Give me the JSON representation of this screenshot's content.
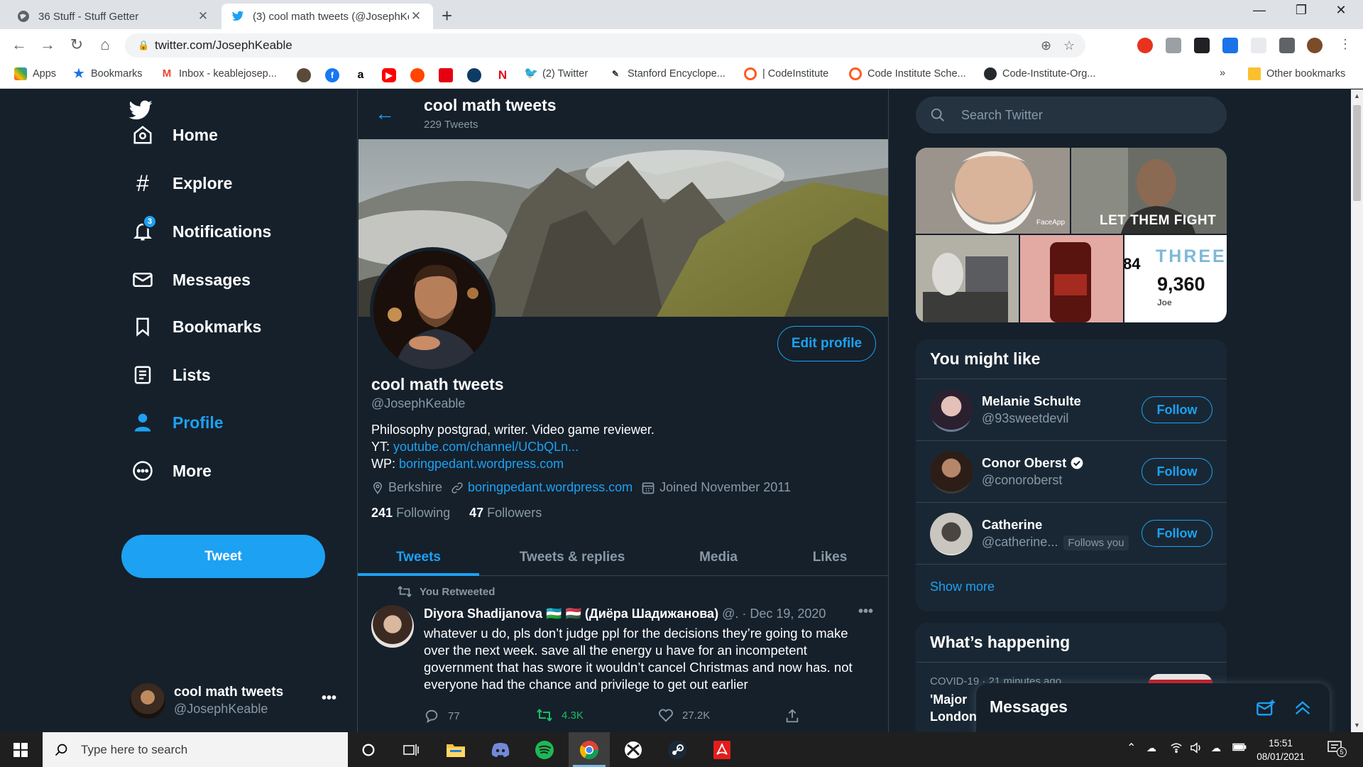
{
  "browser": {
    "tabs": [
      {
        "title": "36 Stuff - Stuff Getter",
        "active": false
      },
      {
        "title": "(3) cool math tweets (@JosephKe",
        "active": true
      }
    ],
    "url": "twitter.com/JosephKeable",
    "bookmarks": [
      {
        "label": "Apps",
        "icon": "apps-grid-icon"
      },
      {
        "label": "Bookmarks",
        "icon": "star-icon"
      },
      {
        "label": "Inbox - keablejosep...",
        "icon": "gmail-icon"
      },
      {
        "label": "(2) Twitter",
        "icon": "twitter-icon"
      },
      {
        "label": "Stanford Encyclope...",
        "icon": "sep-icon"
      },
      {
        "label": "| CodeInstitute",
        "icon": "codeinstitute-icon"
      },
      {
        "label": "Code Institute Sche...",
        "icon": "codeinstitute-icon"
      },
      {
        "label": "Code-Institute-Org...",
        "icon": "github-icon"
      }
    ],
    "other_bookmarks": "Other bookmarks",
    "overflow": "»"
  },
  "sidebar": {
    "items": [
      {
        "label": "Home",
        "icon": "home-icon"
      },
      {
        "label": "Explore",
        "icon": "hashtag-icon"
      },
      {
        "label": "Notifications",
        "icon": "bell-icon",
        "badge": "3"
      },
      {
        "label": "Messages",
        "icon": "envelope-icon"
      },
      {
        "label": "Bookmarks",
        "icon": "bookmark-icon"
      },
      {
        "label": "Lists",
        "icon": "list-icon"
      },
      {
        "label": "Profile",
        "icon": "person-icon",
        "active": true
      },
      {
        "label": "More",
        "icon": "more-circle-icon"
      }
    ],
    "tweet_button": "Tweet",
    "account": {
      "name": "cool math tweets",
      "handle": "@JosephKeable"
    }
  },
  "profile": {
    "header_title": "cool math tweets",
    "tweet_count": "229 Tweets",
    "edit_button": "Edit profile",
    "name": "cool math tweets",
    "handle": "@JosephKeable",
    "bio_line1": "Philosophy postgrad, writer. Video game reviewer.",
    "bio_yt_prefix": "YT: ",
    "bio_yt_link": "youtube.com/channel/UCbQLn...",
    "bio_wp_prefix": "WP: ",
    "bio_wp_link": "boringpedant.wordpress.com",
    "location": "Berkshire",
    "website": "boringpedant.wordpress.com",
    "joined": "Joined November 2011",
    "following_count": "241",
    "following_label": "Following",
    "followers_count": "47",
    "followers_label": "Followers",
    "tabs": [
      "Tweets",
      "Tweets & replies",
      "Media",
      "Likes"
    ]
  },
  "tweet": {
    "retweet_label": "You Retweeted",
    "author": "Diyora Shadijanova 🇺🇿 🇭🇺 (Диёра Шадижанова)",
    "handle_date": "@. · Dec 19, 2020",
    "text": "whatever u do, pls don’t judge ppl for the decisions they’re going to make over the next week. save all the energy u have for an incompetent government that has swore it wouldn’t cancel Christmas and now has. not everyone had the chance and privilege to get out earlier",
    "replies": "77",
    "retweets": "4.3K",
    "likes": "27.2K"
  },
  "right": {
    "search_placeholder": "Search Twitter",
    "media_overlay": {
      "faceapp": "FaceApp",
      "let_them_fight": "LET THEM FIGHT",
      "three": "THREE",
      "number": "9,360",
      "joe": "Joe",
      "eighty_four": "84"
    },
    "you_might_like": {
      "title": "You might like",
      "people": [
        {
          "name": "Melanie Schulte",
          "handle": "@93sweetdevil",
          "button": "Follow"
        },
        {
          "name": "Conor Oberst",
          "handle": "@conoroberst",
          "button": "Follow",
          "verified": true
        },
        {
          "name": "Catherine",
          "handle": "@catherine...",
          "follows_you": "Follows you",
          "button": "Follow"
        }
      ],
      "show_more": "Show more"
    },
    "whats_happening": {
      "title": "What’s happening",
      "meta": "COVID-19 · 21 minutes ago",
      "headline_line1": "'Major",
      "headline_line2": "London"
    }
  },
  "messages_drawer": {
    "title": "Messages"
  },
  "taskbar": {
    "search_placeholder": "Type here to search",
    "time": "15:51",
    "date": "08/01/2021",
    "notif_count": "5"
  },
  "colors": {
    "twitter_blue": "#1da1f2",
    "bg": "#15202b",
    "panel": "#192734",
    "muted": "#8899a6",
    "retweet_green": "#17bf63"
  }
}
